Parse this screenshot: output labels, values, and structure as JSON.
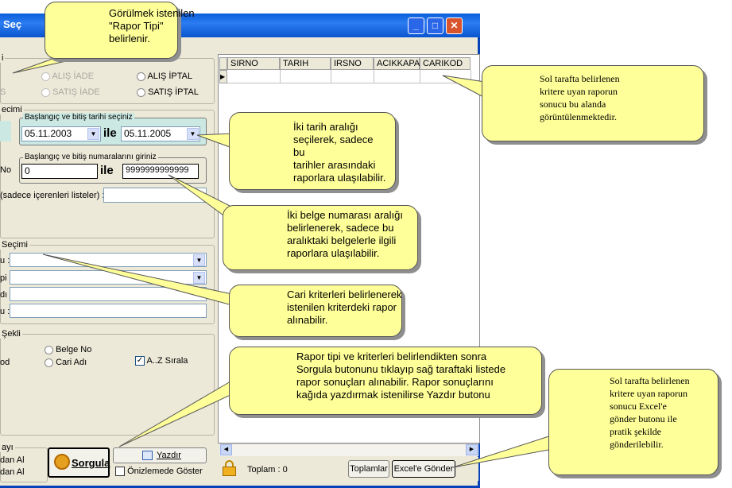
{
  "window": {
    "title": "Seç"
  },
  "report_type": {
    "group_label": "i",
    "options": [
      "ALIŞ İADE",
      "ALIŞ İPTAL",
      "SATIŞ İADE",
      "SATIŞ İPTAL"
    ],
    "left_letter": "S"
  },
  "date_section": {
    "group_label": "ecimi",
    "inner_label": "Başlangıç ve bitiş tarihi seçiniz",
    "start_date": "05.11.2003",
    "end_date": "05.11.2005",
    "ile": "ile"
  },
  "number_section": {
    "inner_label": "Başlangıç ve bitiş numaralarını giriniz",
    "side_label": "No",
    "start_no": "0",
    "end_no": "9999999999999",
    "ile": "ile",
    "contains_label": "(sadece içerenleri listeler) :"
  },
  "cari_section": {
    "group_label": "Seçimi",
    "row_labels": [
      "u :",
      "pi :",
      "dı :",
      "u :"
    ]
  },
  "sort_section": {
    "group_label": "Şekli",
    "left_label": "od",
    "options": [
      "Belge No",
      "Cari Adı"
    ],
    "az_label": "A..Z Sırala"
  },
  "bottom": {
    "group_label": "ayı",
    "left_lines": [
      "dan Al",
      "dan Al"
    ],
    "sorgula": "Sorgula",
    "yazdir": "Yazdır",
    "preview": "Önizlemede Göster"
  },
  "grid": {
    "columns": [
      "SIRNO",
      "TARIH",
      "IRSNO",
      "ACIKKAPA",
      "CARIKOD"
    ],
    "toplam": "Toplam : 0",
    "toplamlar_button": "Toplamlar",
    "excel_button": "Excel'e Gönder"
  },
  "callouts": {
    "rapor_tipi": [
      "Görülmek istenilen",
      "\"Rapor Tipi\"",
      "belirlenir."
    ],
    "result_area": [
      "Sol tarafta belirlenen",
      "kritere uyan raporun",
      "sonucu bu alanda",
      "görüntülenmektedir."
    ],
    "date_range": [
      "İki tarih aralığı",
      "seçilerek, sadece bu",
      "tarihler arasındaki",
      "raporlara ulaşılabilir."
    ],
    "doc_number": [
      "İki belge numarası aralığı",
      "belirlenerek, sadece bu",
      "aralıktaki belgelerle ilgili",
      "raporlara ulaşılabilir."
    ],
    "cari": [
      "Cari kriterleri belirlenerek",
      "istenilen kriterdeki rapor",
      "alınabilir."
    ],
    "sorgula": [
      "Rapor tipi ve kriterleri belirlendikten sonra",
      "Sorgula butonunu tıklayıp sağ taraftaki listede",
      "rapor sonuçları alınabilir. Rapor sonuçlarını",
      "kağıda yazdırmak istenilirse Yazdır butonu"
    ],
    "excel": [
      "Sol tarafta belirlenen",
      "kritere uyan raporun",
      "sonucu Excel'e",
      "gönder butonu ile",
      "pratik şekilde",
      "gönderilebilir."
    ]
  }
}
